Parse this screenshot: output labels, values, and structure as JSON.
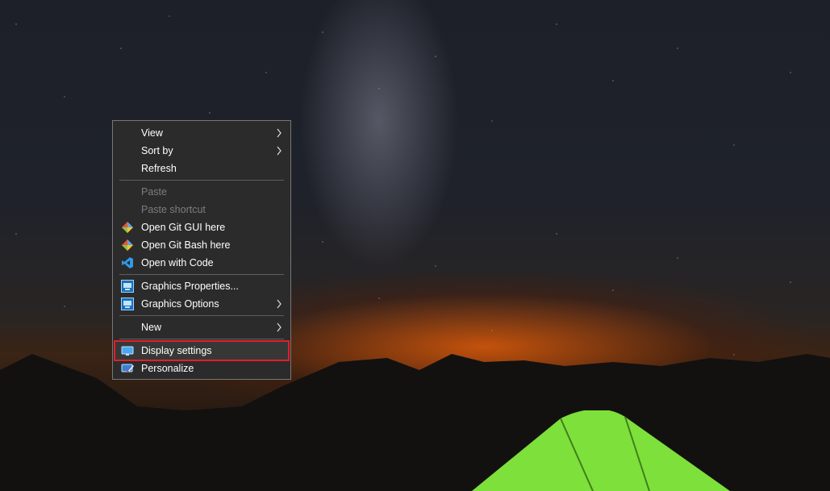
{
  "desktop": {
    "wallpaper_icon": "night-sky-wallpaper"
  },
  "context_menu": {
    "items": [
      {
        "label": "View",
        "submenu": true
      },
      {
        "label": "Sort by",
        "submenu": true
      },
      {
        "label": "Refresh"
      },
      {
        "label": "Paste",
        "disabled": true
      },
      {
        "label": "Paste shortcut",
        "disabled": true
      },
      {
        "label": "Open Git GUI here",
        "icon": "git-icon"
      },
      {
        "label": "Open Git Bash here",
        "icon": "git-icon"
      },
      {
        "label": "Open with Code",
        "icon": "vscode-icon"
      },
      {
        "label": "Graphics Properties...",
        "icon": "intel-graphics-icon"
      },
      {
        "label": "Graphics Options",
        "icon": "intel-graphics-icon",
        "submenu": true
      },
      {
        "label": "New",
        "submenu": true
      },
      {
        "label": "Display settings",
        "icon": "display-icon",
        "highlighted": true
      },
      {
        "label": "Personalize",
        "icon": "personalize-icon"
      }
    ]
  },
  "colors": {
    "menu_background": "#2b2b2b",
    "menu_border": "#777777",
    "highlight_border": "#e0202b",
    "disabled_text": "#7d7d7d",
    "text": "#ffffff"
  }
}
